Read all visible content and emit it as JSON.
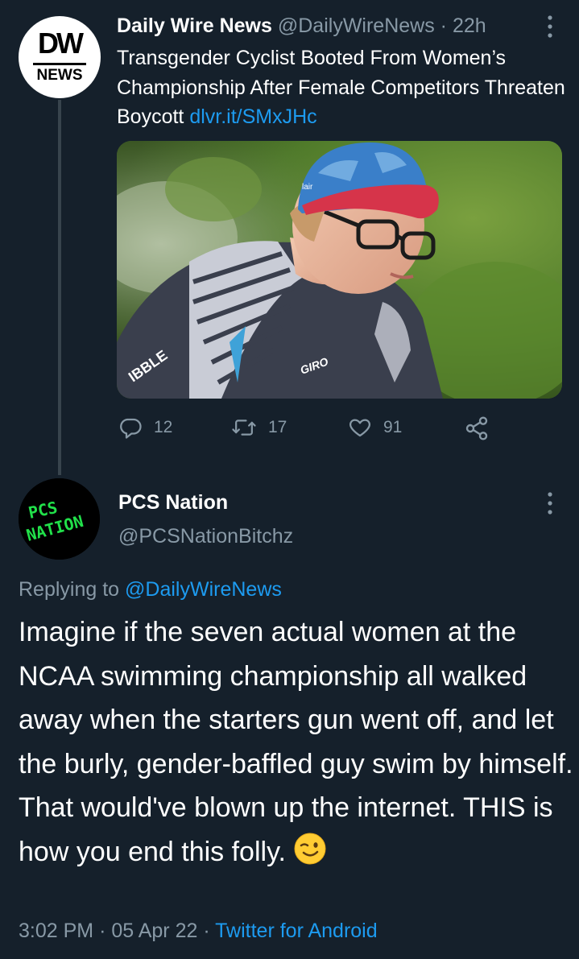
{
  "colors": {
    "background": "#15202b",
    "text": "#ffffff",
    "muted": "#8899a6",
    "link": "#1d9bf0",
    "pcs_green": "#21e14a"
  },
  "tweet1": {
    "avatar": {
      "icon": "daily-wire-news-logo",
      "top": "DW",
      "bottom": "NEWS"
    },
    "display_name": "Daily Wire News",
    "handle": "@DailyWireNews",
    "separator": "·",
    "time": "22h",
    "more_icon": "more-vertical-icon",
    "text": "Transgender Cyclist Booted From Women’s Championship After Female Competitors Threaten Boycott",
    "link": "dlvr.it/SMxJHc",
    "media": {
      "icon": "cyclist-photo",
      "jersey_text_1": "IBBLE",
      "jersey_text_2": "GIRO",
      "cap_text": "lair"
    },
    "actions": {
      "reply_icon": "reply-icon",
      "reply_count": "12",
      "retweet_icon": "retweet-icon",
      "retweet_count": "17",
      "like_icon": "heart-icon",
      "like_count": "91",
      "share_icon": "share-icon"
    }
  },
  "tweet2": {
    "avatar": {
      "icon": "pcs-nation-logo",
      "line1": "PCS",
      "line2": "NATION"
    },
    "display_name": "PCS Nation",
    "handle": "@PCSNationBitchz",
    "more_icon": "more-vertical-icon",
    "replying_prefix": "Replying to",
    "replying_to": "@DailyWireNews",
    "text": "Imagine if the seven actual women at the NCAA swimming championship all walked away when the starters gun went off, and let the burly, gender-baffled guy swim by himself. That would've blown up the internet. THIS is how you end this folly.",
    "emoji": "winking-face-emoji",
    "time": "3:02 PM",
    "date": "05 Apr 22",
    "separator": "·",
    "source": "Twitter for Android"
  }
}
